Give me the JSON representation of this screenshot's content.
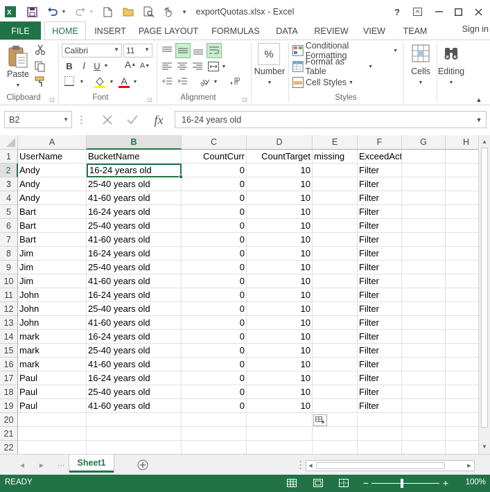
{
  "window": {
    "title": "exportQuotas.xlsx - Excel",
    "help": "?"
  },
  "tabs": [
    "FILE",
    "HOME",
    "INSERT",
    "PAGE LAYOUT",
    "FORMULAS",
    "DATA",
    "REVIEW",
    "VIEW",
    "TEAM"
  ],
  "active_tab": "HOME",
  "signin": "Sign in",
  "ribbon": {
    "clipboard": {
      "label": "Clipboard",
      "paste": "Paste"
    },
    "font": {
      "label": "Font",
      "name": "Calibri",
      "size": "11",
      "bold": "B",
      "italic": "I",
      "underline": "U",
      "grow": "A",
      "shrink": "A",
      "font_color": "A"
    },
    "alignment": {
      "label": "Alignment"
    },
    "number": {
      "label": "Number",
      "percent": "%"
    },
    "styles": {
      "label": "Styles",
      "conditional": "Conditional Formatting",
      "format_table": "Format as Table",
      "cell_styles": "Cell Styles"
    },
    "cells": {
      "label": "Cells"
    },
    "editing": {
      "label": "Editing"
    }
  },
  "formula_bar": {
    "name_box": "B2",
    "fx": "fx",
    "value": "16-24 years old"
  },
  "columns": [
    "A",
    "B",
    "C",
    "D",
    "E",
    "F",
    "G",
    "H"
  ],
  "selected_column": "B",
  "headers": [
    "UserName",
    "BucketName",
    "CountCurr",
    "CountTarget",
    "missing",
    "ExceedAction"
  ],
  "rows": [
    [
      "Andy",
      "16-24 years old",
      "0",
      "10",
      "",
      "Filter"
    ],
    [
      "Andy",
      "25-40 years old",
      "0",
      "10",
      "",
      "Filter"
    ],
    [
      "Andy",
      "41-60 years old",
      "0",
      "10",
      "",
      "Filter"
    ],
    [
      "Bart",
      "16-24 years old",
      "0",
      "10",
      "",
      "Filter"
    ],
    [
      "Bart",
      "25-40 years old",
      "0",
      "10",
      "",
      "Filter"
    ],
    [
      "Bart",
      "41-60 years old",
      "0",
      "10",
      "",
      "Filter"
    ],
    [
      "Jim",
      "16-24 years old",
      "0",
      "10",
      "",
      "Filter"
    ],
    [
      "Jim",
      "25-40 years old",
      "0",
      "10",
      "",
      "Filter"
    ],
    [
      "Jim",
      "41-60 years old",
      "0",
      "10",
      "",
      "Filter"
    ],
    [
      "John",
      "16-24 years old",
      "0",
      "10",
      "",
      "Filter"
    ],
    [
      "John",
      "25-40 years old",
      "0",
      "10",
      "",
      "Filter"
    ],
    [
      "John",
      "41-60 years old",
      "0",
      "10",
      "",
      "Filter"
    ],
    [
      "mark",
      "16-24 years old",
      "0",
      "10",
      "",
      "Filter"
    ],
    [
      "mark",
      "25-40 years old",
      "0",
      "10",
      "",
      "Filter"
    ],
    [
      "mark",
      "41-60 years old",
      "0",
      "10",
      "",
      "Filter"
    ],
    [
      "Paul",
      "16-24 years old",
      "0",
      "10",
      "",
      "Filter"
    ],
    [
      "Paul",
      "25-40 years old",
      "0",
      "10",
      "",
      "Filter"
    ],
    [
      "Paul",
      "41-60 years old",
      "0",
      "10",
      "",
      "Filter"
    ]
  ],
  "row_numbers": [
    "1",
    "2",
    "3",
    "4",
    "5",
    "6",
    "7",
    "8",
    "9",
    "10",
    "11",
    "12",
    "13",
    "14",
    "15",
    "16",
    "17",
    "18",
    "19",
    "20",
    "21",
    "22"
  ],
  "active_cell": "B2",
  "sheets": [
    "Sheet1"
  ],
  "status": {
    "mode": "READY",
    "zoom": "100%"
  },
  "colors": {
    "accent": "#217346"
  }
}
